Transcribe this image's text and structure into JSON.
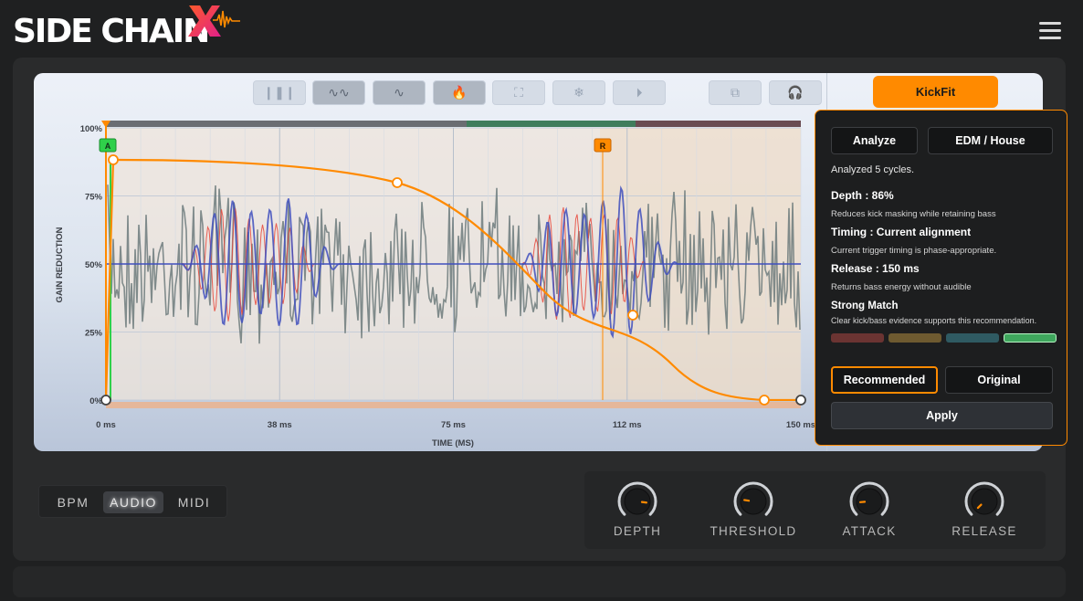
{
  "app": {
    "logo_text": "SIDE CHAIN",
    "logo_mark": "X"
  },
  "colors": {
    "accent": "#ff8a00",
    "wave_grey": "#6d7b7c",
    "wave_blue": "#3f4fbd",
    "wave_red": "#e8463a",
    "curve": "#ff8a00"
  },
  "toolbar": [
    {
      "icon": "waveform-icon",
      "glyph": "❙❚❙"
    },
    {
      "icon": "sine-wave-icon",
      "glyph": "∿∿",
      "active": true
    },
    {
      "icon": "envelope-wave-icon",
      "glyph": "∿",
      "active": true
    },
    {
      "icon": "flame-icon",
      "glyph": "🔥",
      "active": true
    },
    {
      "icon": "expand-icon",
      "glyph": "⛶"
    },
    {
      "icon": "snowflake-icon",
      "glyph": "❄"
    },
    {
      "icon": "play-circle-icon",
      "glyph": "⏵"
    },
    {
      "icon": "compare-icon",
      "glyph": "⧉"
    },
    {
      "icon": "headphones-icon",
      "glyph": "🎧"
    }
  ],
  "graph": {
    "y_axis_title": "GAIN REDUCTION",
    "x_axis_title": "TIME (MS)",
    "y_ticks": [
      "100%",
      "75%",
      "50%",
      "25%",
      "0%"
    ],
    "x_ticks": [
      "0 ms",
      "38 ms",
      "75 ms",
      "112 ms",
      "150 ms"
    ],
    "marker_attack": "A",
    "marker_release": "R"
  },
  "kickfit": {
    "label": "KickFit"
  },
  "popup": {
    "analyze_label": "Analyze",
    "genre_label": "EDM / House",
    "status": "Analyzed 5 cycles.",
    "depth_title": "Depth : 86%",
    "depth_desc": "Reduces kick masking while retaining bass",
    "timing_title": "Timing : Current alignment",
    "timing_desc": "Current trigger timing is phase-appropriate.",
    "release_title": "Release : 150 ms",
    "release_desc": "Returns bass energy without audible",
    "match_title": "Strong Match",
    "match_desc": "Clear kick/bass evidence supports this recommendation.",
    "match_level": 4,
    "recommended_label": "Recommended",
    "original_label": "Original",
    "apply_label": "Apply"
  },
  "mode": {
    "bpm": "BPM",
    "audio": "AUDIO",
    "midi": "MIDI",
    "selected": "AUDIO"
  },
  "knobs": [
    {
      "label": "DEPTH",
      "value": 0.86
    },
    {
      "label": "THRESHOLD",
      "value": 0.2
    },
    {
      "label": "ATTACK",
      "value": 0.15
    },
    {
      "label": "RELEASE",
      "value": 0.0
    }
  ]
}
